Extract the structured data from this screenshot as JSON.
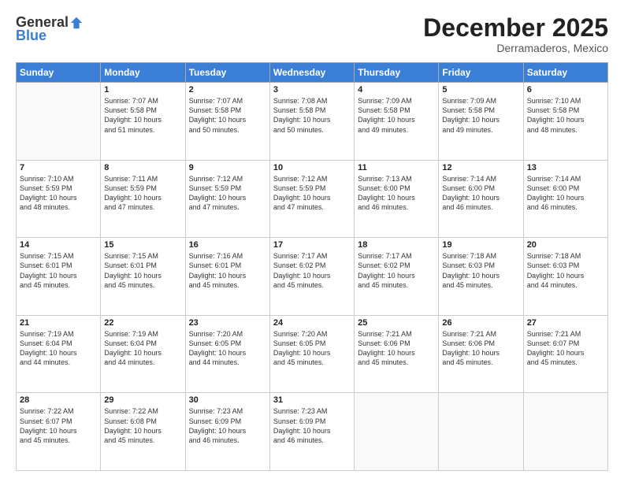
{
  "logo": {
    "general": "General",
    "blue": "Blue"
  },
  "title": "December 2025",
  "location": "Derramaderos, Mexico",
  "days_header": [
    "Sunday",
    "Monday",
    "Tuesday",
    "Wednesday",
    "Thursday",
    "Friday",
    "Saturday"
  ],
  "weeks": [
    [
      {
        "day": "",
        "info": ""
      },
      {
        "day": "1",
        "info": "Sunrise: 7:07 AM\nSunset: 5:58 PM\nDaylight: 10 hours\nand 51 minutes."
      },
      {
        "day": "2",
        "info": "Sunrise: 7:07 AM\nSunset: 5:58 PM\nDaylight: 10 hours\nand 50 minutes."
      },
      {
        "day": "3",
        "info": "Sunrise: 7:08 AM\nSunset: 5:58 PM\nDaylight: 10 hours\nand 50 minutes."
      },
      {
        "day": "4",
        "info": "Sunrise: 7:09 AM\nSunset: 5:58 PM\nDaylight: 10 hours\nand 49 minutes."
      },
      {
        "day": "5",
        "info": "Sunrise: 7:09 AM\nSunset: 5:58 PM\nDaylight: 10 hours\nand 49 minutes."
      },
      {
        "day": "6",
        "info": "Sunrise: 7:10 AM\nSunset: 5:58 PM\nDaylight: 10 hours\nand 48 minutes."
      }
    ],
    [
      {
        "day": "7",
        "info": "Sunrise: 7:10 AM\nSunset: 5:59 PM\nDaylight: 10 hours\nand 48 minutes."
      },
      {
        "day": "8",
        "info": "Sunrise: 7:11 AM\nSunset: 5:59 PM\nDaylight: 10 hours\nand 47 minutes."
      },
      {
        "day": "9",
        "info": "Sunrise: 7:12 AM\nSunset: 5:59 PM\nDaylight: 10 hours\nand 47 minutes."
      },
      {
        "day": "10",
        "info": "Sunrise: 7:12 AM\nSunset: 5:59 PM\nDaylight: 10 hours\nand 47 minutes."
      },
      {
        "day": "11",
        "info": "Sunrise: 7:13 AM\nSunset: 6:00 PM\nDaylight: 10 hours\nand 46 minutes."
      },
      {
        "day": "12",
        "info": "Sunrise: 7:14 AM\nSunset: 6:00 PM\nDaylight: 10 hours\nand 46 minutes."
      },
      {
        "day": "13",
        "info": "Sunrise: 7:14 AM\nSunset: 6:00 PM\nDaylight: 10 hours\nand 46 minutes."
      }
    ],
    [
      {
        "day": "14",
        "info": "Sunrise: 7:15 AM\nSunset: 6:01 PM\nDaylight: 10 hours\nand 45 minutes."
      },
      {
        "day": "15",
        "info": "Sunrise: 7:15 AM\nSunset: 6:01 PM\nDaylight: 10 hours\nand 45 minutes."
      },
      {
        "day": "16",
        "info": "Sunrise: 7:16 AM\nSunset: 6:01 PM\nDaylight: 10 hours\nand 45 minutes."
      },
      {
        "day": "17",
        "info": "Sunrise: 7:17 AM\nSunset: 6:02 PM\nDaylight: 10 hours\nand 45 minutes."
      },
      {
        "day": "18",
        "info": "Sunrise: 7:17 AM\nSunset: 6:02 PM\nDaylight: 10 hours\nand 45 minutes."
      },
      {
        "day": "19",
        "info": "Sunrise: 7:18 AM\nSunset: 6:03 PM\nDaylight: 10 hours\nand 45 minutes."
      },
      {
        "day": "20",
        "info": "Sunrise: 7:18 AM\nSunset: 6:03 PM\nDaylight: 10 hours\nand 44 minutes."
      }
    ],
    [
      {
        "day": "21",
        "info": "Sunrise: 7:19 AM\nSunset: 6:04 PM\nDaylight: 10 hours\nand 44 minutes."
      },
      {
        "day": "22",
        "info": "Sunrise: 7:19 AM\nSunset: 6:04 PM\nDaylight: 10 hours\nand 44 minutes."
      },
      {
        "day": "23",
        "info": "Sunrise: 7:20 AM\nSunset: 6:05 PM\nDaylight: 10 hours\nand 44 minutes."
      },
      {
        "day": "24",
        "info": "Sunrise: 7:20 AM\nSunset: 6:05 PM\nDaylight: 10 hours\nand 45 minutes."
      },
      {
        "day": "25",
        "info": "Sunrise: 7:21 AM\nSunset: 6:06 PM\nDaylight: 10 hours\nand 45 minutes."
      },
      {
        "day": "26",
        "info": "Sunrise: 7:21 AM\nSunset: 6:06 PM\nDaylight: 10 hours\nand 45 minutes."
      },
      {
        "day": "27",
        "info": "Sunrise: 7:21 AM\nSunset: 6:07 PM\nDaylight: 10 hours\nand 45 minutes."
      }
    ],
    [
      {
        "day": "28",
        "info": "Sunrise: 7:22 AM\nSunset: 6:07 PM\nDaylight: 10 hours\nand 45 minutes."
      },
      {
        "day": "29",
        "info": "Sunrise: 7:22 AM\nSunset: 6:08 PM\nDaylight: 10 hours\nand 45 minutes."
      },
      {
        "day": "30",
        "info": "Sunrise: 7:23 AM\nSunset: 6:09 PM\nDaylight: 10 hours\nand 46 minutes."
      },
      {
        "day": "31",
        "info": "Sunrise: 7:23 AM\nSunset: 6:09 PM\nDaylight: 10 hours\nand 46 minutes."
      },
      {
        "day": "",
        "info": ""
      },
      {
        "day": "",
        "info": ""
      },
      {
        "day": "",
        "info": ""
      }
    ]
  ]
}
